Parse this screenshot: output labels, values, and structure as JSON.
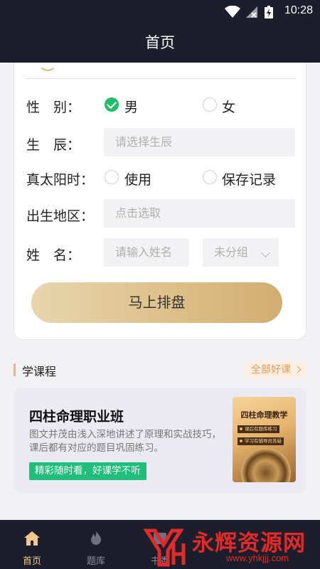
{
  "status_bar": {
    "time": "10:28"
  },
  "header": {
    "title": "首页"
  },
  "form": {
    "gender": {
      "label": "性　别：",
      "options": [
        {
          "text": "男",
          "checked": true
        },
        {
          "text": "女",
          "checked": false
        }
      ]
    },
    "birth_time": {
      "label": "生　辰：",
      "placeholder": "请选择生辰"
    },
    "true_solar_time": {
      "label": "真太阳时：",
      "options": [
        {
          "text": "使用",
          "checked": false
        },
        {
          "text": "保存记录",
          "checked": false
        }
      ]
    },
    "birthplace": {
      "label": "出生地区：",
      "placeholder": "点击选取"
    },
    "name": {
      "label": "姓　名：",
      "placeholder": "请输入姓名",
      "group_value": "未分组"
    },
    "submit_label": "马上排盘"
  },
  "courses_section": {
    "title": "学课程",
    "more_label": "全部好课",
    "course": {
      "title": "四柱命理职业班",
      "description": "图文并茂由浅入深地讲述了原理和实战技巧，课后都有对应的题目巩固练习。",
      "tag": "精彩随时看，好课学不听",
      "thumbnail": {
        "title": "四柱命理教学",
        "line1": "课后有题库练习",
        "line2": "学习有辅导员答疑"
      }
    }
  },
  "tab_bar": {
    "tabs": [
      {
        "label": "首页",
        "icon": "home-icon",
        "active": true
      },
      {
        "label": "题库",
        "icon": "flame-icon",
        "active": false
      },
      {
        "label": "书香",
        "icon": "book-icon",
        "active": false
      }
    ]
  },
  "watermark": {
    "text": "永辉资源网",
    "url": "www.yhkjjj.com"
  },
  "colors": {
    "bar_background": "#1c1f2b",
    "accent_gold": "#ddc08a",
    "check_green": "#1fbf6a",
    "watermark_red": "#e12a2a"
  }
}
